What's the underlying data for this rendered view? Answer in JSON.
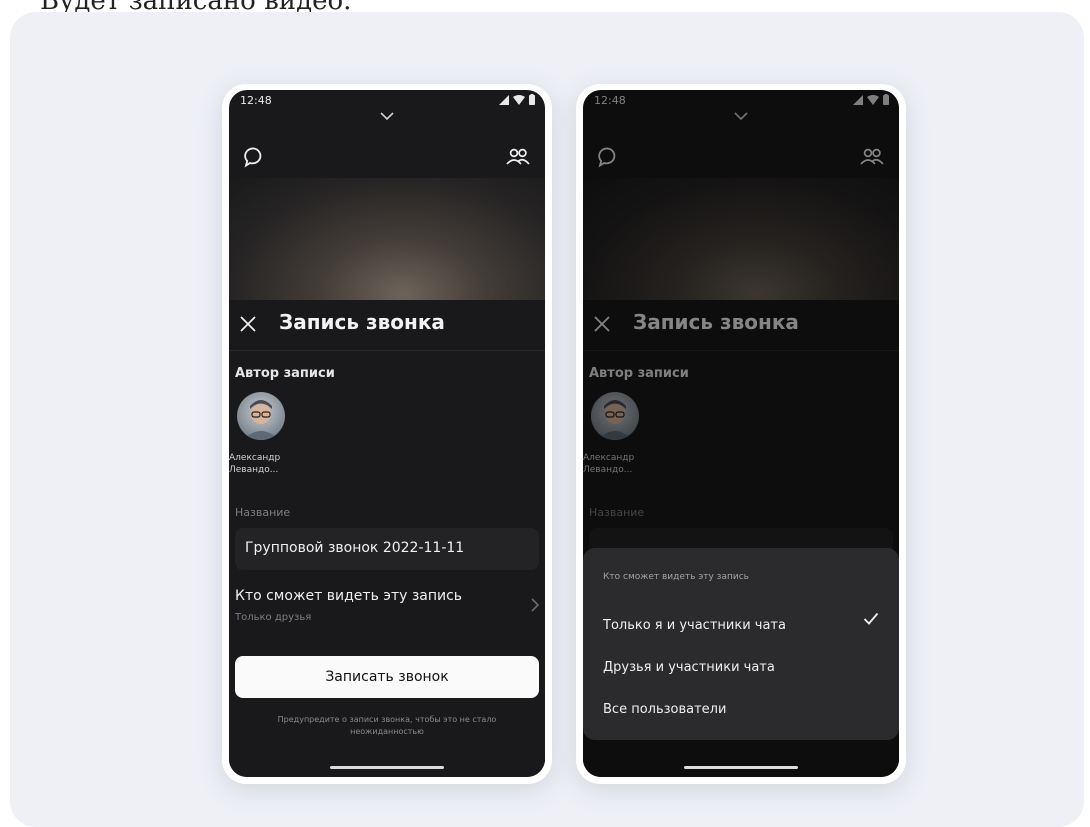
{
  "caption": "Будет записано видео.",
  "left_screen": {
    "status": {
      "time": "12:48"
    },
    "sheet": {
      "title": "Запись звонка",
      "author_label": "Автор записи",
      "author_name": "Александр Левандо...",
      "name_label": "Название",
      "name_value": "Групповой звонок 2022-11-11",
      "privacy_title": "Кто сможет видеть эту запись",
      "privacy_value": "Только друзья",
      "record_button": "Записать звонок",
      "hint": "Предупредите о записи звонка, чтобы это не стало неожиданностью"
    }
  },
  "right_screen": {
    "status": {
      "time": "12:48"
    },
    "sheet": {
      "title": "Запись звонка",
      "author_label": "Автор записи",
      "author_name": "Александр Левандо...",
      "name_label": "Название"
    },
    "popup": {
      "title": "Кто сможет видеть эту запись",
      "options": [
        {
          "label": "Только я и участники чата",
          "selected": true
        },
        {
          "label": "Друзья и участники чата",
          "selected": false
        },
        {
          "label": "Все пользователи",
          "selected": false
        }
      ]
    }
  },
  "icons": {
    "chat": "chat-bubble-icon",
    "people": "people-icon",
    "close": "close-icon",
    "chevron": "chevron-down-icon",
    "check": "check-icon"
  },
  "colors": {
    "background": "#eef0f6",
    "screen": "#19191b",
    "popup": "#2b2b2e",
    "button": "#fafafa"
  }
}
